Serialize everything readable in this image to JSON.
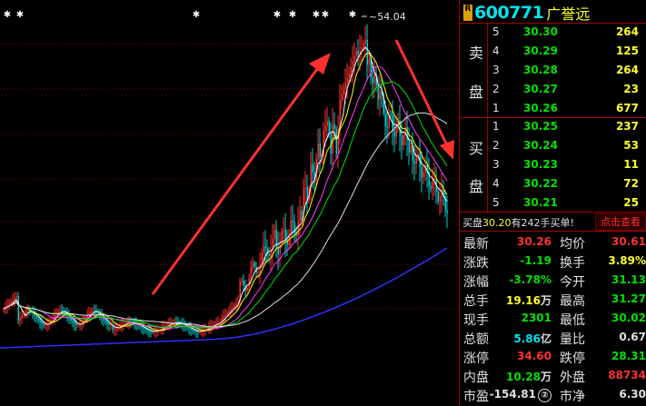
{
  "chart": {
    "peak_label": "54.04",
    "top_marker_glyph": "✱",
    "top_marker_count": 13,
    "colors": {
      "up": "#ff3030",
      "down": "#00d0d0",
      "ma5": "#ffffff",
      "ma10": "#ffff00",
      "ma20": "#ff40ff",
      "ma30": "#00e000",
      "ma60": "#e0e0e0",
      "ma120": "#3030ff",
      "arrow": "#ff3030"
    }
  },
  "header": {
    "badge": "R",
    "code": "600771",
    "name": "广誉远"
  },
  "order_book": {
    "sell_label": [
      "卖",
      "盘"
    ],
    "buy_label": [
      "买",
      "盘"
    ],
    "sell": [
      {
        "level": "5",
        "price": "30.30",
        "volume": "264"
      },
      {
        "level": "4",
        "price": "30.29",
        "volume": "125"
      },
      {
        "level": "3",
        "price": "30.28",
        "volume": "264"
      },
      {
        "level": "2",
        "price": "30.27",
        "volume": "23"
      },
      {
        "level": "1",
        "price": "30.26",
        "volume": "677"
      }
    ],
    "buy": [
      {
        "level": "1",
        "price": "30.25",
        "volume": "237"
      },
      {
        "level": "2",
        "price": "30.24",
        "volume": "53"
      },
      {
        "level": "3",
        "price": "30.23",
        "volume": "11"
      },
      {
        "level": "4",
        "price": "30.22",
        "volume": "72"
      },
      {
        "level": "5",
        "price": "30.21",
        "volume": "25"
      }
    ]
  },
  "notice": {
    "prefix": "买盘",
    "price": "30.20",
    "mid": "有242手买单!"
  },
  "view_button": "点击查看",
  "quote": [
    {
      "k1": "最新",
      "v1": "30.26",
      "c1": "up",
      "u1": "",
      "k2": "均价",
      "v2": "30.61",
      "c2": "up",
      "u2": ""
    },
    {
      "k1": "涨跌",
      "v1": "-1.19",
      "c1": "dn",
      "u1": "",
      "k2": "换手",
      "v2": "3.89%",
      "c2": "yl",
      "u2": ""
    },
    {
      "k1": "涨幅",
      "v1": "-3.78%",
      "c1": "dn",
      "u1": "",
      "k2": "今开",
      "v2": "31.13",
      "c2": "dn",
      "u2": ""
    },
    {
      "k1": "总手",
      "v1": "19.16",
      "c1": "yl",
      "u1": "万",
      "k2": "最高",
      "v2": "31.27",
      "c2": "dn",
      "u2": ""
    },
    {
      "k1": "现手",
      "v1": "2301",
      "c1": "dn",
      "u1": "",
      "k2": "最低",
      "v2": "30.02",
      "c2": "dn",
      "u2": ""
    },
    {
      "k1": "总额",
      "v1": "5.86",
      "c1": "cy",
      "u1": "亿",
      "k2": "量比",
      "v2": "0.67",
      "c2": "wh",
      "u2": ""
    },
    {
      "k1": "涨停",
      "v1": "34.60",
      "c1": "up",
      "u1": "",
      "k2": "跌停",
      "v2": "28.31",
      "c2": "dn",
      "u2": ""
    },
    {
      "k1": "内盘",
      "v1": "10.28",
      "c1": "dn",
      "u1": "万",
      "k2": "外盘",
      "v2": "88734",
      "c2": "up",
      "u2": ""
    },
    {
      "k1": "市盈",
      "v1": "-154.81",
      "c1": "wh",
      "u1": "②",
      "k2": "市净",
      "v2": "6.30",
      "c2": "wh",
      "u2": ""
    }
  ]
}
